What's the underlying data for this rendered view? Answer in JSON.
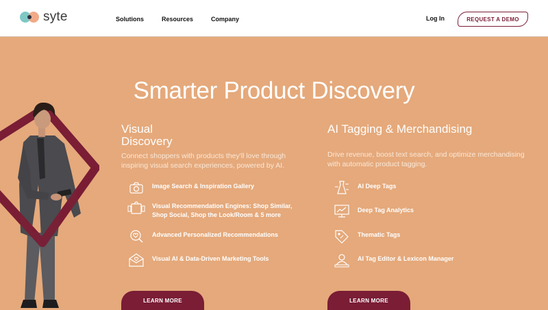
{
  "brand": {
    "name": "syte"
  },
  "nav": {
    "links": [
      "Solutions",
      "Resources",
      "Company"
    ],
    "login": "Log In",
    "demo": "REQUEST A DEMO"
  },
  "hero": {
    "title": "Smarter Product Discovery"
  },
  "visual": {
    "heading_line1": "Visual",
    "heading_line2": "Discovery",
    "description": "Connect shoppers with products they'll love through inspiring visual search experiences, powered by AI.",
    "features": [
      {
        "icon": "camera-icon",
        "label": "Image Search & Inspiration Gallery"
      },
      {
        "icon": "shopping-bag-icon",
        "label": "Visual Recommendation Engines: Shop Similar, Shop Social, Shop the Look/Room & 5 more"
      },
      {
        "icon": "heart-search-icon",
        "label": "Advanced Personalized Recommendations"
      },
      {
        "icon": "envelope-heart-icon",
        "label": "Visual AI & Data-Driven Marketing Tools"
      }
    ],
    "cta": "LEARN MORE"
  },
  "tagging": {
    "heading": "AI Tagging & Merchandising",
    "description": "Drive revenue, boost text search, and optimize merchandising with automatic product tagging.",
    "features": [
      {
        "icon": "dress-tags-icon",
        "label": "AI Deep Tags"
      },
      {
        "icon": "chart-monitor-icon",
        "label": "Deep Tag Analytics"
      },
      {
        "icon": "tag-icon",
        "label": "Thematic Tags"
      },
      {
        "icon": "user-editor-icon",
        "label": "AI Tag Editor & Lexicon Manager"
      }
    ],
    "cta": "LEARN MORE"
  },
  "colors": {
    "background": "#e5a97b",
    "accent": "#7a1d35",
    "text": "#ffffff"
  }
}
